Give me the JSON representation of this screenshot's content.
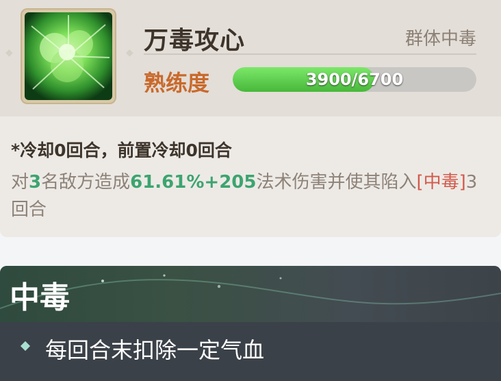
{
  "skill": {
    "name": "万毒攻心",
    "type": "群体中毒",
    "proficiency_label": "熟练度",
    "progress_text": "3900/6700",
    "progress_fraction": 0.582,
    "cooldown": "*冷却0回合，前置冷却0回合",
    "desc": {
      "p1": "对",
      "targets": "3",
      "p2": "名敌方造成",
      "damage": "61.61%+205",
      "p3": "法术伤害并使其陷入",
      "status": "[中毒]",
      "p4": "3回合"
    },
    "icon": "poison-burst-icon"
  },
  "status_effect": {
    "title": "中毒",
    "bullet": "每回合末扣除一定气血"
  },
  "colors": {
    "accent_green": "#3da46f",
    "accent_red": "#d35a4b",
    "proficiency_orange": "#c96a2c",
    "progress_fill": "#56c447"
  }
}
